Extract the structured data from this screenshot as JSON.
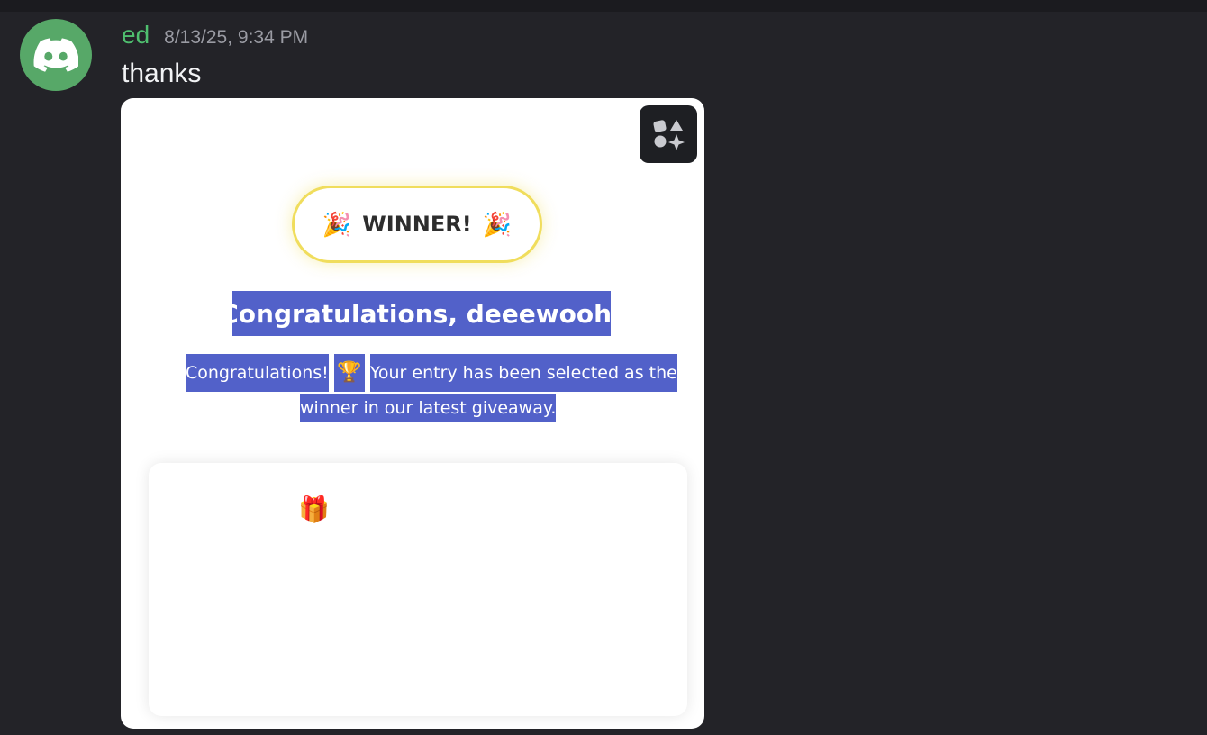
{
  "message": {
    "author": "ed",
    "timestamp": "8/13/25, 9:34 PM",
    "content": "thanks",
    "avatar_icon": "discord-logo-icon",
    "colors": {
      "background": "#232328",
      "author": "#4fbf6f",
      "avatar": "#57a868",
      "timestamp": "#9a9ba3"
    }
  },
  "embed": {
    "apps_icon": "app-launcher-icon",
    "badge": {
      "left_emoji": "🎉",
      "text": "WINNER!",
      "right_emoji": "🎉"
    },
    "headline": "Congratulations, deeewooh!",
    "body": {
      "part1": "Congratulations!",
      "trophy": "🏆",
      "part2": "Your entry has been selected as the",
      "part3": "winner in our latest giveaway."
    },
    "prize_icon": "🎁",
    "colors": {
      "selection": "#5261c9",
      "badge_border": "#f0dd5c"
    }
  }
}
